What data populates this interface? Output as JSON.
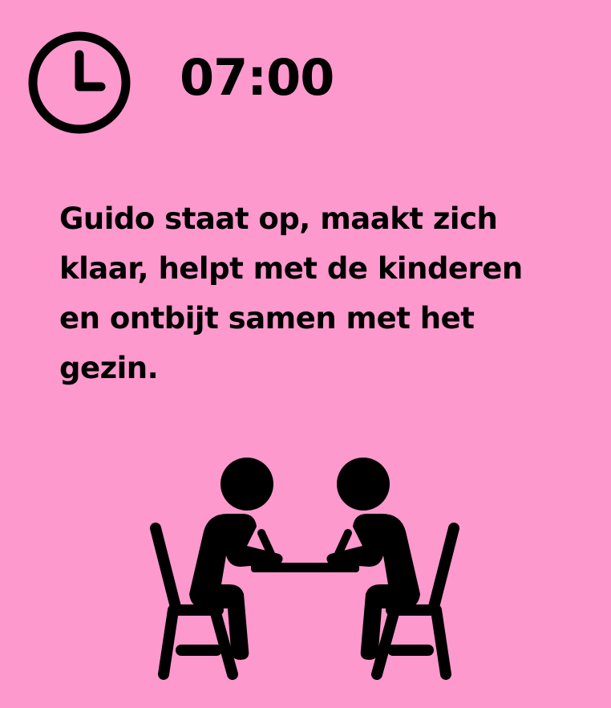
{
  "card": {
    "background": "#fd99cd",
    "time": "07:00",
    "clock_icon": "clock-icon",
    "description_lines": [
      "Guido staat op, maakt zich",
      "klaar, helpt met de kinderen",
      "en ontbijt samen met het",
      "gezin."
    ],
    "illustration": "two-people-at-table-icon"
  }
}
